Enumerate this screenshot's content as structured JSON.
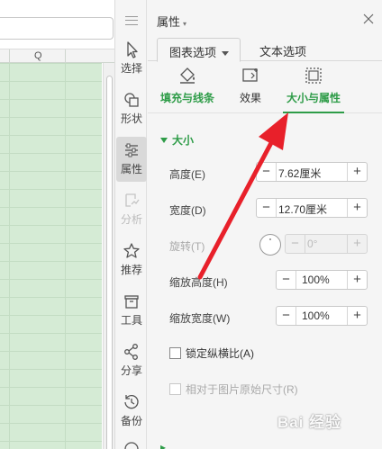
{
  "sheet": {
    "column_letter": "Q"
  },
  "rail": {
    "items": [
      {
        "label": "选择",
        "icon": "cursor-icon"
      },
      {
        "label": "形状",
        "icon": "shapes-icon"
      },
      {
        "label": "属性",
        "icon": "sliders-icon",
        "active": true
      },
      {
        "label": "分析",
        "icon": "analysis-icon",
        "disabled": true
      },
      {
        "label": "推荐",
        "icon": "star-icon"
      },
      {
        "label": "工具",
        "icon": "toolbox-icon"
      },
      {
        "label": "分享",
        "icon": "share-icon"
      },
      {
        "label": "备份",
        "icon": "history-icon"
      }
    ]
  },
  "panel": {
    "title": "属性",
    "tabs": {
      "chart_options": "图表选项",
      "text_options": "文本选项"
    },
    "subtabs": {
      "fill_line": "填充与线条",
      "effect": "效果",
      "size_props": "大小与属性"
    },
    "section_title": "大小",
    "props": {
      "height_label": "高度(E)",
      "height_value": "7.62厘米",
      "width_label": "宽度(D)",
      "width_value": "12.70厘米",
      "rotate_label": "旋转(T)",
      "rotate_value": "0°",
      "scale_h_label": "缩放高度(H)",
      "scale_h_value": "100%",
      "scale_w_label": "缩放宽度(W)",
      "scale_w_value": "100%"
    },
    "checks": {
      "lock_ratio": "锁定纵横比(A)",
      "relative_original": "相对于图片原始尺寸(R)"
    }
  },
  "colors": {
    "accent_green": "#2e9c48",
    "annotation_red": "#e8202a",
    "grid_green": "#d5ebd5"
  },
  "watermark": "Bai 经验"
}
